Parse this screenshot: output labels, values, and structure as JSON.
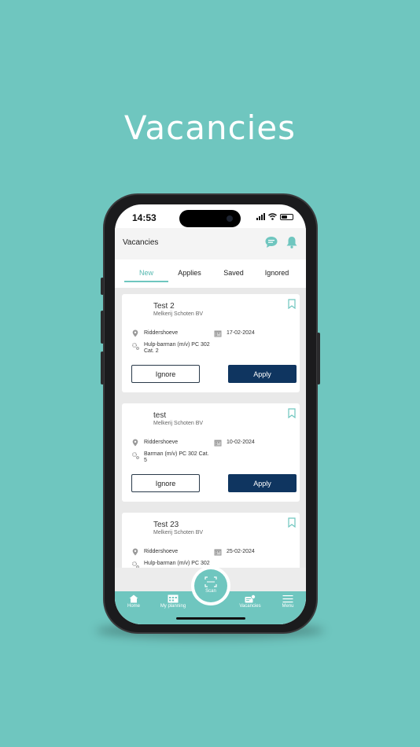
{
  "hero": {
    "title": "Vacancies"
  },
  "status_bar": {
    "time": "14:53"
  },
  "header": {
    "title": "Vacancies",
    "chat_icon": "chat-bubble-icon",
    "bell_icon": "bell-icon"
  },
  "tabs": [
    {
      "label": "New",
      "active": true
    },
    {
      "label": "Applies",
      "active": false
    },
    {
      "label": "Saved",
      "active": false
    },
    {
      "label": "Ignored",
      "active": false
    }
  ],
  "vacancies": [
    {
      "title": "Test 2",
      "company": "Melkerij Schoten BV",
      "location": "Riddershoeve",
      "date": "17-02-2024",
      "role_line1": "Hulp-barman (m/v) PC 302",
      "role_line2": "Cat. 2",
      "ignore_label": "Ignore",
      "apply_label": "Apply"
    },
    {
      "title": "test",
      "company": "Melkerij Schoten BV",
      "location": "Riddershoeve",
      "date": "10-02-2024",
      "role_line1": "Barman (m/v) PC 302 Cat.",
      "role_line2": "5",
      "ignore_label": "Ignore",
      "apply_label": "Apply"
    },
    {
      "title": "Test 23",
      "company": "Melkerij Schoten BV",
      "location": "Riddershoeve",
      "date": "25-02-2024",
      "role_line1": "Hulp-barman (m/v) PC 302",
      "role_line2": "",
      "ignore_label": "Ignore",
      "apply_label": "Apply"
    }
  ],
  "bottom_nav": {
    "home": "Home",
    "planning": "My planning",
    "scan": "Scan",
    "vacancies": "Vacancies",
    "menu": "Menu"
  },
  "colors": {
    "accent": "#6fc6bf",
    "apply_button": "#0f3560",
    "list_background": "#e9e9e9"
  }
}
